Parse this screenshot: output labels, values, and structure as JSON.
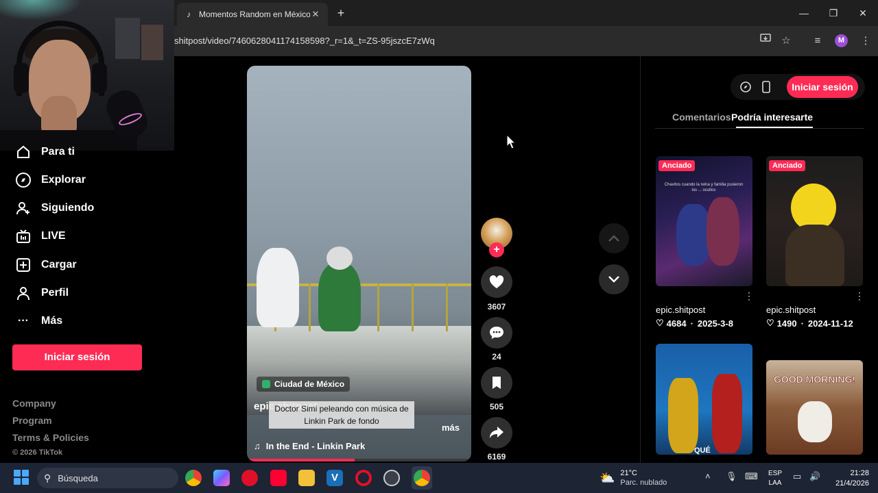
{
  "browser": {
    "tab_title": "Momentos Random en México",
    "tab_favicon": "tiktok-icon",
    "new_tab_icon": "+",
    "close_tab_icon": "✕",
    "url": "shitpost/video/7460628041174158598?_r=1&_t=ZS-95jszcE7zWq",
    "profile_initial": "M",
    "window_controls": [
      "—",
      "❐",
      "✕"
    ]
  },
  "sidebar": {
    "items": [
      {
        "label": "Para ti",
        "icon": "home-icon"
      },
      {
        "label": "Explorar",
        "icon": "compass-icon"
      },
      {
        "label": "Siguiendo",
        "icon": "user-plus-icon"
      },
      {
        "label": "LIVE",
        "icon": "live-tv-icon"
      },
      {
        "label": "Cargar",
        "icon": "upload-plus-icon"
      },
      {
        "label": "Perfil",
        "icon": "person-icon"
      },
      {
        "label": "Más",
        "icon": "more-dots-icon"
      }
    ],
    "login_label": "Iniciar sesión",
    "footer": [
      "Company",
      "Program",
      "Terms & Policies"
    ],
    "copyright": "© 2026 TikTok"
  },
  "video": {
    "location": "Ciudad de México",
    "author": "epic.shitpost",
    "caption": "Doctor Simi peleando con música de Linkin Park de fondo",
    "more_label": "más",
    "music": "In the End - Linkin Park",
    "progress": 0.48
  },
  "actions": {
    "likes": "3607",
    "comments": "24",
    "saves": "505",
    "shares": "6169"
  },
  "right_panel": {
    "login_label": "Iniciar sesión",
    "tabs": [
      "Comentarios",
      "Podría interesarte"
    ],
    "active_tab": "Podría interesarte",
    "cards": [
      {
        "pinned": "Anciado",
        "author": "epic.shitpost",
        "likes": "4684",
        "date": "2025-3-8",
        "overlay_text": "Chavitos cuando la reina y familia pusieron los ... ocultos"
      },
      {
        "pinned": "Anciado",
        "author": "epic.shitpost",
        "likes": "1490",
        "date": "2024-11-12"
      },
      {
        "overlay_text": "QUÉ"
      },
      {
        "overlay_text": "GOOD MORNING!"
      }
    ]
  },
  "taskbar": {
    "search_placeholder": "Búsqueda",
    "weather_temp": "21°C",
    "weather_desc": "Parc. nublado",
    "lang_line1": "ESP",
    "lang_line2": "LAA",
    "time": "21:28",
    "date": "21/4/2026"
  },
  "colors": {
    "accent": "#fe2c55",
    "background": "#000000",
    "taskbar": "#1d2433"
  }
}
